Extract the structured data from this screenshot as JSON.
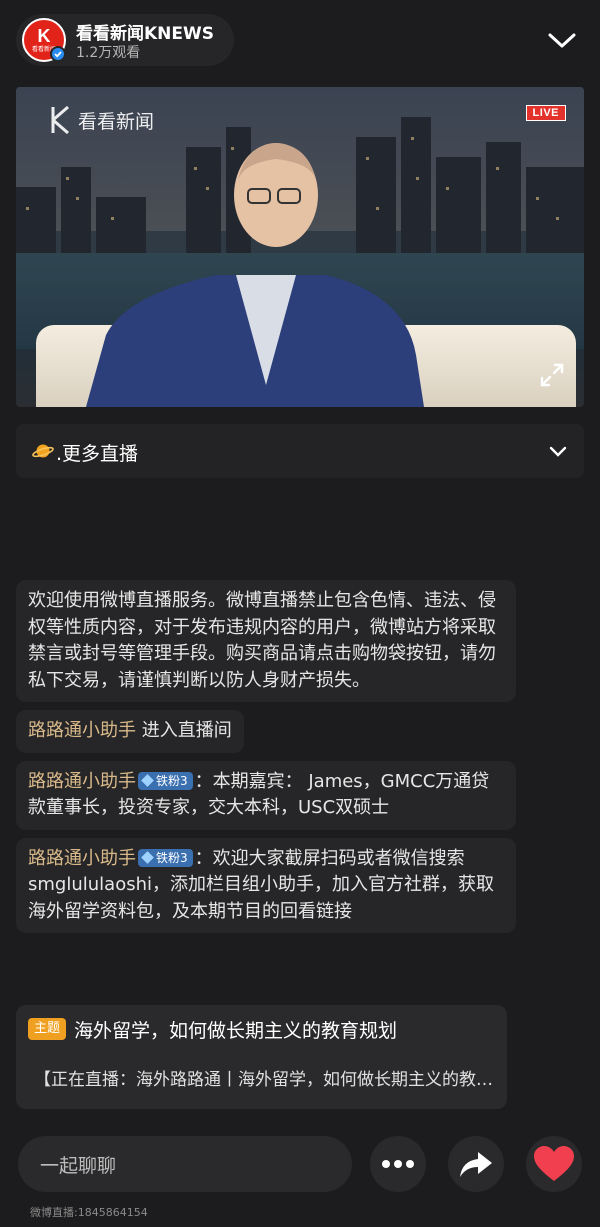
{
  "header": {
    "host_name": "看看新闻KNEWS",
    "views": "1.2万观看",
    "avatar_text": "K",
    "avatar_sub": "看看新闻"
  },
  "video": {
    "logo_text": "看看新闻",
    "live_label": "LIVE"
  },
  "more_live": {
    "label": ".更多直播"
  },
  "chat": {
    "system_notice": "欢迎使用微博直播服务。微博直播禁止包含色情、违法、侵权等性质内容，对于发布违规内容的用户，微博站方将采取禁言或封号等管理手段。购买商品请点击购物袋按钮，请勿私下交易，请谨慎判断以防人身财产损失。",
    "messages": [
      {
        "user": "路路通小助手",
        "badge": "",
        "text": " 进入直播间"
      },
      {
        "user": "路路通小助手",
        "badge": "铁粉3",
        "text": "：本期嘉宾： James，GMCC万通贷款董事长，投资专家，交大本科，USC双硕士"
      },
      {
        "user": "路路通小助手",
        "badge": "铁粉3",
        "text": "：欢迎大家截屏扫码或者微信搜索smglululaoshi，添加栏目组小助手，加入官方社群，获取海外留学资料包，及本期节目的回看链接"
      }
    ]
  },
  "topic": {
    "tag": "主题",
    "title": "海外留学，如何做长期主义的教育规划",
    "desc": "【正在直播：海外路路通丨海外留学，如何做长期主义的教育规划"
  },
  "bottom_bar": {
    "input_placeholder": "一起聊聊",
    "footer_id": "微博直播:1845864154"
  },
  "colors": {
    "background": "#1c1c1e",
    "username": "#d9b98a",
    "live_red": "#e3322b",
    "topic_tag": "#f0a020",
    "like_heart": "#f23f4f",
    "fan_badge": "#3a6fb0"
  },
  "icons": [
    "chevron-down-icon",
    "verified-icon",
    "fullscreen-icon",
    "planet-icon",
    "more-dots-icon",
    "share-icon",
    "heart-icon"
  ]
}
